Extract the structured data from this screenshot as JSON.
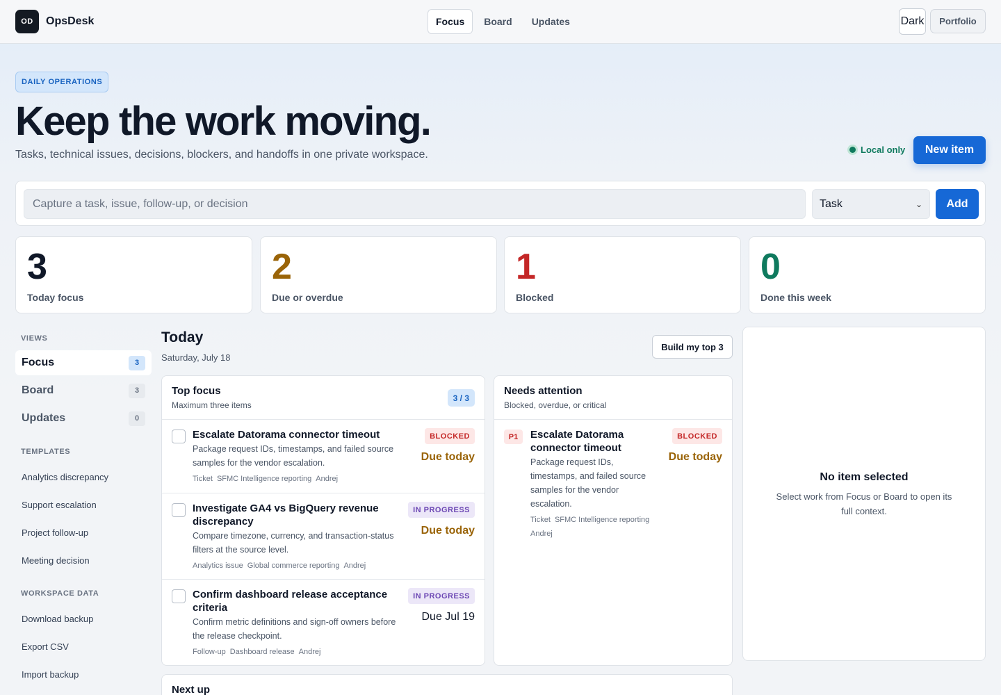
{
  "app": {
    "logo_text": "OD",
    "name": "OpsDesk"
  },
  "topnav": {
    "tabs": [
      "Focus",
      "Board",
      "Updates"
    ],
    "active": "Focus"
  },
  "top_actions": {
    "theme_label": "Dark",
    "portfolio_label": "Portfolio"
  },
  "hero": {
    "eyebrow": "DAILY OPERATIONS",
    "title": "Keep the work moving.",
    "subtitle": "Tasks, technical issues, decisions, blockers, and handoffs in one private workspace.",
    "storage_status": "Local only",
    "new_item_label": "New item"
  },
  "capture": {
    "placeholder": "Capture a task, issue, follow-up, or decision",
    "value": "",
    "type_selected": "Task",
    "add_label": "Add"
  },
  "stats": [
    {
      "value": "3",
      "label": "Today focus",
      "color": "#101828"
    },
    {
      "value": "2",
      "label": "Due or overdue",
      "color": "#9a6408"
    },
    {
      "value": "1",
      "label": "Blocked",
      "color": "#c42727"
    },
    {
      "value": "0",
      "label": "Done this week",
      "color": "#0f7a5e"
    }
  ],
  "sidebar": {
    "views_heading": "VIEWS",
    "views": [
      {
        "label": "Focus",
        "count": "3"
      },
      {
        "label": "Board",
        "count": "3"
      },
      {
        "label": "Updates",
        "count": "0"
      }
    ],
    "templates_heading": "TEMPLATES",
    "templates": [
      "Analytics discrepancy",
      "Support escalation",
      "Project follow-up",
      "Meeting decision"
    ],
    "data_heading": "WORKSPACE DATA",
    "data_actions": [
      "Download backup",
      "Export CSV",
      "Import backup"
    ]
  },
  "today": {
    "title": "Today",
    "date": "Saturday, July 18",
    "build_label": "Build my top 3"
  },
  "top_focus": {
    "title": "Top focus",
    "subtitle": "Maximum three items",
    "count": "3 / 3",
    "items": [
      {
        "title": "Escalate Datorama connector timeout",
        "desc": "Package request IDs, timestamps, and failed source samples for the vendor escalation.",
        "type": "Ticket",
        "project": "SFMC Intelligence reporting",
        "owner": "Andrej",
        "status": "BLOCKED",
        "due": "Due today"
      },
      {
        "title": "Investigate GA4 vs BigQuery revenue discrepancy",
        "desc": "Compare timezone, currency, and transaction-status filters at the source level.",
        "type": "Analytics issue",
        "project": "Global commerce reporting",
        "owner": "Andrej",
        "status": "IN PROGRESS",
        "due": "Due today"
      },
      {
        "title": "Confirm dashboard release acceptance criteria",
        "desc": "Confirm metric definitions and sign-off owners before the release checkpoint.",
        "type": "Follow-up",
        "project": "Dashboard release",
        "owner": "Andrej",
        "status": "IN PROGRESS",
        "due": "Due Jul 19"
      }
    ]
  },
  "needs_attention": {
    "title": "Needs attention",
    "subtitle": "Blocked, overdue, or critical",
    "items": [
      {
        "priority": "P1",
        "title": "Escalate Datorama connector timeout",
        "desc": "Package request IDs, timestamps, and failed source samples for the vendor escalation.",
        "type": "Ticket",
        "project": "SFMC Intelligence reporting",
        "owner": "Andrej",
        "status": "BLOCKED",
        "due": "Due today"
      }
    ]
  },
  "detail": {
    "empty_title": "No item selected",
    "empty_subtitle": "Select work from Focus or Board to open its full context."
  },
  "next_up": {
    "title": "Next up"
  }
}
